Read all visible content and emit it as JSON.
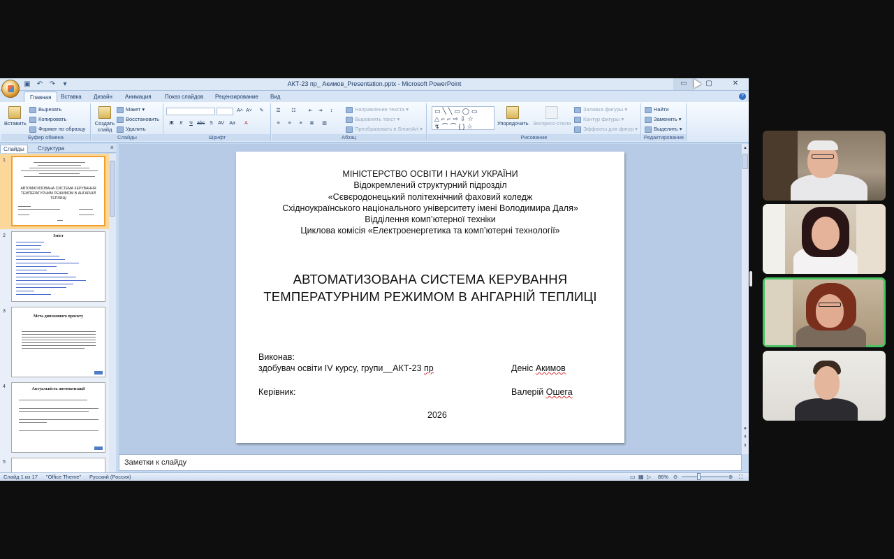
{
  "window": {
    "title": "АКТ-23 пр_ Акимов_Presentation.pptx - Microsoft PowerPoint",
    "min": "▭",
    "max": "▢",
    "close": "✕"
  },
  "ribbon_tabs": [
    "Главная",
    "Вставка",
    "Дизайн",
    "Анимация",
    "Показ слайдов",
    "Рецензирование",
    "Вид"
  ],
  "ribbon": {
    "clipboard": {
      "title": "Буфер обмена",
      "paste": "Вставить",
      "cut": "Вырезать",
      "copy": "Копировать",
      "format": "Формат по образцу"
    },
    "slides": {
      "title": "Слайды",
      "new": "Создать слайд",
      "layout": "Макет",
      "reset": "Восстановить",
      "delete": "Удалить"
    },
    "font": {
      "title": "Шрифт"
    },
    "paragraph": {
      "title": "Абзац",
      "dir": "Направление текста",
      "align": "Выровнять текст",
      "smartart": "Преобразовать в SmartArt"
    },
    "drawing": {
      "title": "Рисование",
      "arrange": "Упорядочить",
      "styles": "Экспресс-стили",
      "fill": "Заливка фигуры",
      "outline": "Контур фигуры",
      "effects": "Эффекты для фигур"
    },
    "editing": {
      "title": "Редактирование",
      "find": "Найти",
      "replace": "Заменить",
      "select": "Выделить"
    }
  },
  "pane": {
    "tab_slides": "Слайды",
    "tab_outline": "Структура",
    "close": "×"
  },
  "thumbnails": [
    {
      "num": "1",
      "title": "АВТОМАТИЗОВАНА СИСТЕМА КЕРУВАННЯ ТЕМПЕРАТУРНИМ РЕЖИМОМ В АНГАРНІЙ ТЕПЛИЦІ"
    },
    {
      "num": "2",
      "title": "Зміст"
    },
    {
      "num": "3",
      "title": "Мета дипломного проєкту"
    },
    {
      "num": "4",
      "title": "Актуальність автоматизації"
    },
    {
      "num": "5",
      "title": ""
    }
  ],
  "slide": {
    "header": [
      "МІНІСТЕРСТВО ОСВІТИ І НАУКИ УКРАЇНИ",
      "Відокремлений структурний підрозділ",
      "«Сєвєродонецький політехнічний фаховий коледж",
      "Східноукраїнського національного університету імені Володимира Даля»",
      "Відділення комп’ютерної техніки",
      "Циклова комісія «Електроенергетика та комп’ютерні технології»"
    ],
    "title_line1": "АВТОМАТИЗОВАНА СИСТЕМА КЕРУВАННЯ",
    "title_line2": "ТЕМПЕРАТУРНИМ РЕЖИМОМ В АНГАРНІЙ ТЕПЛИЦІ",
    "executed_label": "Виконав:",
    "student_line": "здобувач освіти IV курсу, групи__АКТ-23 ",
    "student_group_suffix": "пр",
    "student_name_first": "Деніс ",
    "student_name_last": "Акимов",
    "supervisor_label": "Керівник:",
    "supervisor_first": "Валерій ",
    "supervisor_last": "Ошега",
    "year": "2026"
  },
  "notes": "Заметки к слайду",
  "status": {
    "slide_counter": "Слайд 1 из 17",
    "theme": "\"Office Theme\"",
    "language": "Русский (Россия)",
    "zoom": "86%"
  },
  "participants": [
    {
      "name": "participant-1",
      "active": false
    },
    {
      "name": "participant-2",
      "active": false
    },
    {
      "name": "participant-3",
      "active": true
    },
    {
      "name": "participant-4",
      "active": false
    }
  ]
}
